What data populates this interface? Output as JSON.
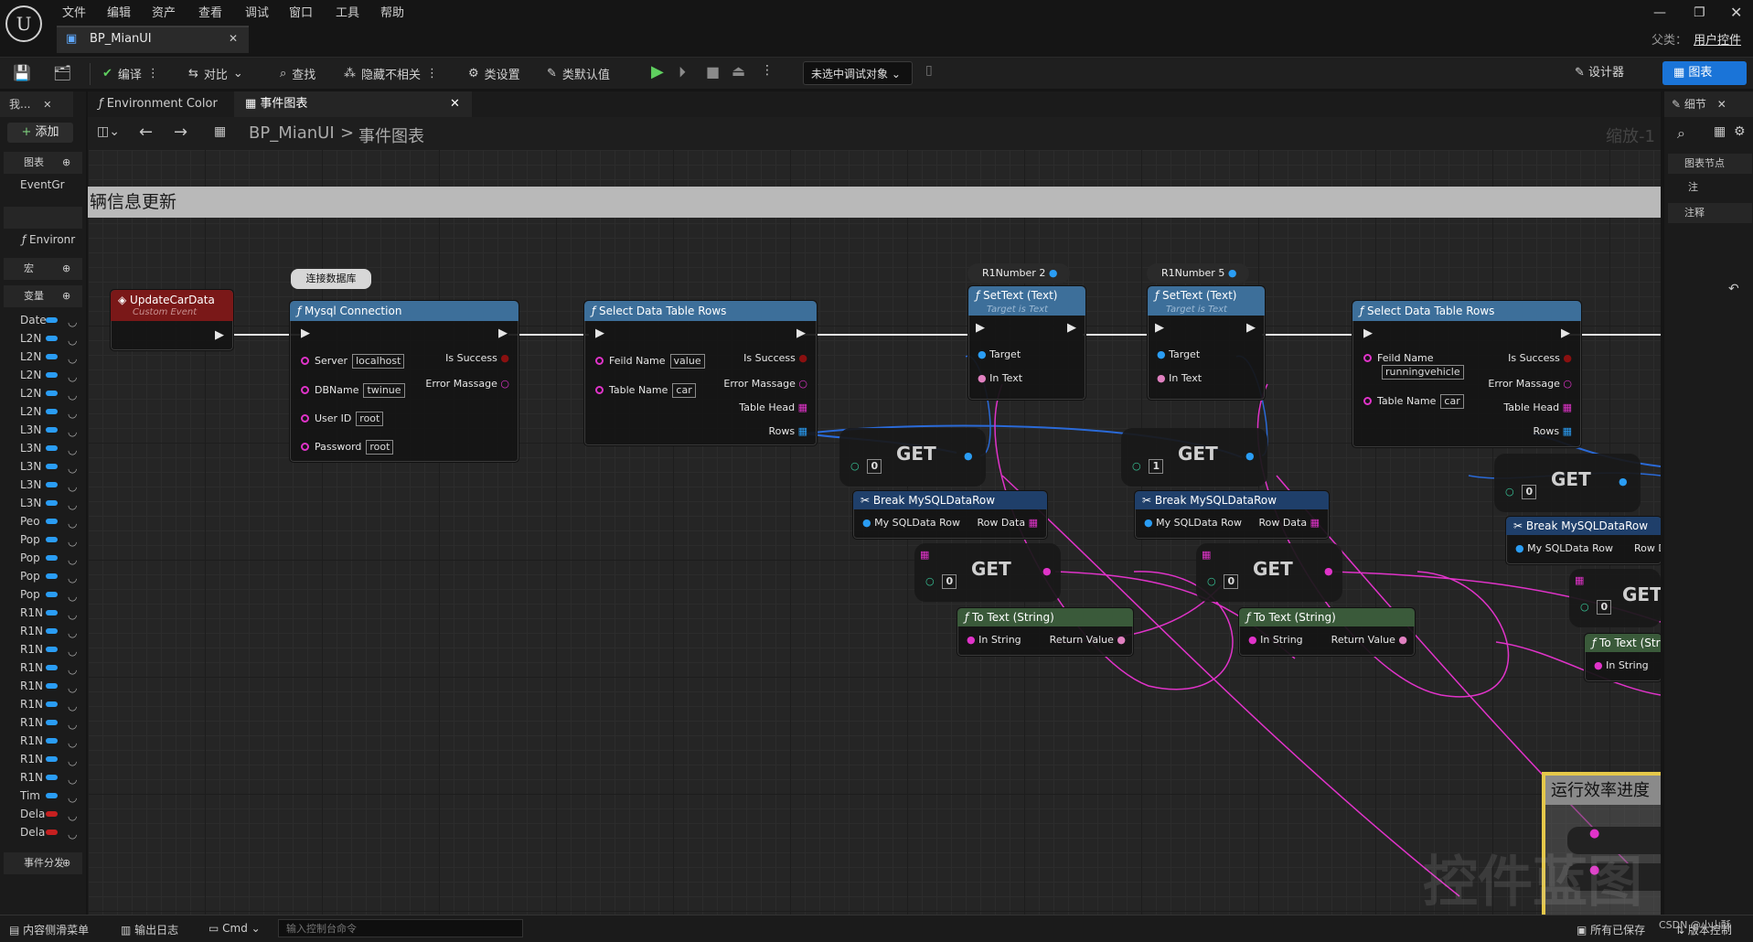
{
  "menu": [
    "文件",
    "编辑",
    "资产",
    "查看",
    "调试",
    "窗口",
    "工具",
    "帮助"
  ],
  "doc_tab": "BP_MianUI",
  "parent": {
    "label": "父类：",
    "value": "用户控件"
  },
  "toolbar": {
    "compile": "编译",
    "diff": "对比",
    "find": "查找",
    "hide_unrelated": "隐藏不相关",
    "class_settings": "类设置",
    "class_defaults": "类默认值",
    "debug_select": "未选中调试对象",
    "designer": "设计器",
    "graph": "图表"
  },
  "left": {
    "tab": "我...",
    "add": "添加",
    "graphs": "图表",
    "event_graph": "EventGr",
    "function": "Environr",
    "macros": "宏",
    "variables": "变量",
    "dispatchers": "事件分发",
    "vars": [
      {
        "name": "Date",
        "color": "#2a9df4"
      },
      {
        "name": "L2N",
        "color": "#2a9df4"
      },
      {
        "name": "L2N",
        "color": "#2a9df4"
      },
      {
        "name": "L2N",
        "color": "#2a9df4"
      },
      {
        "name": "L2N",
        "color": "#2a9df4"
      },
      {
        "name": "L2N",
        "color": "#2a9df4"
      },
      {
        "name": "L3N",
        "color": "#2a9df4"
      },
      {
        "name": "L3N",
        "color": "#2a9df4"
      },
      {
        "name": "L3N",
        "color": "#2a9df4"
      },
      {
        "name": "L3N",
        "color": "#2a9df4"
      },
      {
        "name": "L3N",
        "color": "#2a9df4"
      },
      {
        "name": "Peo",
        "color": "#2a9df4"
      },
      {
        "name": "Pop",
        "color": "#2a9df4"
      },
      {
        "name": "Pop",
        "color": "#2a9df4"
      },
      {
        "name": "Pop",
        "color": "#2a9df4"
      },
      {
        "name": "Pop",
        "color": "#2a9df4"
      },
      {
        "name": "R1N",
        "color": "#2a9df4"
      },
      {
        "name": "R1N",
        "color": "#2a9df4"
      },
      {
        "name": "R1N",
        "color": "#2a9df4"
      },
      {
        "name": "R1N",
        "color": "#2a9df4"
      },
      {
        "name": "R1N",
        "color": "#2a9df4"
      },
      {
        "name": "R1N",
        "color": "#2a9df4"
      },
      {
        "name": "R1N",
        "color": "#2a9df4"
      },
      {
        "name": "R1N",
        "color": "#2a9df4"
      },
      {
        "name": "R1N",
        "color": "#2a9df4"
      },
      {
        "name": "R1N",
        "color": "#2a9df4"
      },
      {
        "name": "Tim",
        "color": "#2a9df4"
      },
      {
        "name": "Dela",
        "color": "#c62020"
      },
      {
        "name": "Dela",
        "color": "#c62020"
      }
    ]
  },
  "graph_tabs": {
    "env": "Environment Color",
    "event": "事件图表"
  },
  "breadcrumb": {
    "bp": "BP_MianUI",
    "sep": ">",
    "graph": "事件图表",
    "zoom": "缩放-1"
  },
  "comment": {
    "title": "辆信息更新",
    "efficiency": "运行效率进度",
    "watermark": "控件蓝图"
  },
  "nodes": {
    "event": {
      "title": "UpdateCarData",
      "sub": "Custom Event"
    },
    "comment_bubble": "连接数据库",
    "mysql": {
      "title": "Mysql Connection",
      "server": "Server",
      "server_v": "localhost",
      "db": "DBName",
      "db_v": "twinue",
      "user": "User ID",
      "user_v": "root",
      "pw": "Password",
      "pw_v": "root",
      "succ": "Is Success",
      "err": "Error Massage"
    },
    "select1": {
      "title": "Select Data Table Rows",
      "field": "Feild Name",
      "field_v": "value",
      "table": "Table Name",
      "table_v": "car",
      "succ": "Is Success",
      "err": "Error Massage",
      "head": "Table Head",
      "rows": "Rows"
    },
    "r1n2": "R1Number 2",
    "r1n5": "R1Number 5",
    "settext": {
      "title": "SetText (Text)",
      "sub": "Target is Text",
      "target": "Target",
      "intext": "In Text"
    },
    "select2": {
      "title": "Select Data Table Rows",
      "field": "Feild Name",
      "field_v": "runningvehicle",
      "table": "Table Name",
      "table_v": "car",
      "succ": "Is Success",
      "err": "Error Massage",
      "head": "Table Head",
      "rows": "Rows"
    },
    "get": "GET",
    "idx0": "0",
    "idx1": "1",
    "break": {
      "title": "Break MySQLDataRow",
      "row": "My SQLData Row",
      "rowdata": "Row Data",
      "rowdata_short": "Row D"
    },
    "totext": {
      "title": "To Text (String)",
      "title_short": "To Text (Str",
      "in": "In String",
      "ret": "Return Value"
    }
  },
  "right": {
    "tab": "细节",
    "graph_node": "图表节点",
    "note": "注",
    "comments": "注释"
  },
  "status": {
    "drawer": "内容侧滑菜单",
    "log": "输出日志",
    "cmd": "Cmd",
    "console_ph": "输入控制台命令",
    "saved": "所有已保存",
    "vc": "版本控制",
    "wm": "CSDN @小山酥"
  }
}
